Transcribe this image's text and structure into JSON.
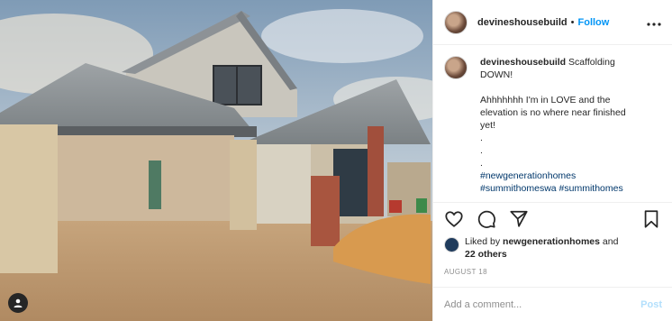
{
  "post": {
    "username": "devineshousebuild",
    "follow_label": "Follow",
    "separator": "•",
    "more_label": "•••",
    "caption": {
      "username": "devineshousebuild",
      "lines": [
        "Scaffolding",
        "DOWN!",
        "",
        "Ahhhhhhh I'm in LOVE and the",
        "elevation is no where near finished",
        "yet!",
        ".",
        ".",
        "."
      ],
      "hashtags": [
        "#newgenerationhomes",
        "#summithomeswa #summithomes"
      ]
    },
    "likes": {
      "prefix": "Liked by",
      "user": "newgenerationhomes",
      "conjunction": "and",
      "others": "22 others"
    },
    "date": "AUGUST 18",
    "comment": {
      "placeholder": "Add a comment...",
      "post_label": "Post"
    },
    "icons": {
      "like": "heart-icon",
      "comment": "comment-bubble-icon",
      "share": "paper-plane-icon",
      "save": "bookmark-icon",
      "tag": "person-tag-icon"
    },
    "colors": {
      "follow": "#0095f6",
      "post_disabled": "#b2dffc",
      "hashtag": "#00376b",
      "muted": "#8e8e8e"
    }
  }
}
